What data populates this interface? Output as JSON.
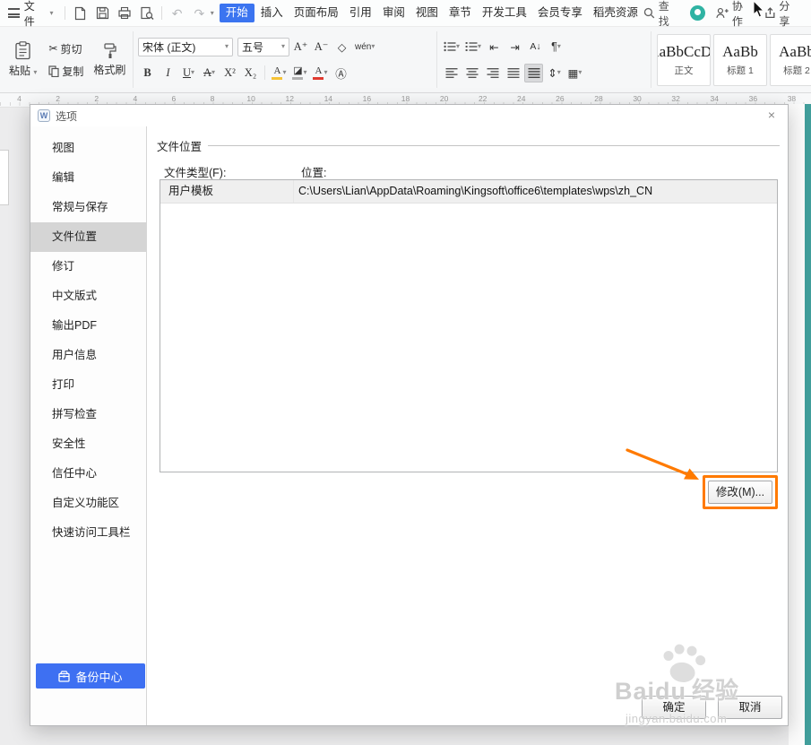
{
  "menubar": {
    "file_label": "文件",
    "tabs": [
      {
        "label": "开始",
        "active": true
      },
      {
        "label": "插入"
      },
      {
        "label": "页面布局"
      },
      {
        "label": "引用"
      },
      {
        "label": "审阅"
      },
      {
        "label": "视图"
      },
      {
        "label": "章节"
      },
      {
        "label": "开发工具"
      },
      {
        "label": "会员专享"
      },
      {
        "label": "稻壳资源"
      }
    ],
    "search_label": "查找",
    "collab_label": "协作",
    "share_label": "分享"
  },
  "ribbon": {
    "paste_label": "粘贴",
    "cut_label": "剪切",
    "copy_label": "复制",
    "format_painter_label": "格式刷",
    "font_name": "宋体 (正文)",
    "font_size": "五号",
    "grow_font_label": "A⁺",
    "shrink_font_label": "A⁻",
    "pinyin_label": "wén",
    "bold_label": "B",
    "italic_label": "I",
    "underline_label": "U",
    "strike_label": "A",
    "superscript_label": "X²",
    "subscript_label": "X₂",
    "highlight_label": "A",
    "shading_glyph": "◪",
    "font_color_label": "A",
    "enclose_label": "Ⓐ",
    "outdent_glyph": "⇤",
    "indent_glyph": "⇥",
    "sort_label": "A↓",
    "marks_glyph": "¶",
    "line_spacing_glyph": "⇕",
    "borders_glyph": "▦",
    "clear_format_glyph": "◇",
    "styles": [
      {
        "sample": "AaBbCcDd",
        "name": "正文"
      },
      {
        "sample": "AaBb",
        "name": "标题 1"
      },
      {
        "sample": "AaBb",
        "name": "标题 2"
      }
    ]
  },
  "ruler": {
    "numbers": [
      "4",
      "2",
      "2",
      "4",
      "6",
      "8",
      "10",
      "12",
      "14",
      "16",
      "18",
      "20",
      "22",
      "24",
      "26",
      "28",
      "30",
      "32",
      "34",
      "36",
      "38"
    ]
  },
  "dialog": {
    "title": "选项",
    "logo_letter": "W",
    "close_glyph": "×",
    "sidebar": {
      "items": [
        {
          "label": "视图"
        },
        {
          "label": "编辑"
        },
        {
          "label": "常规与保存"
        },
        {
          "label": "文件位置",
          "selected": true
        },
        {
          "label": "修订"
        },
        {
          "label": "中文版式"
        },
        {
          "label": "输出PDF"
        },
        {
          "label": "用户信息"
        },
        {
          "label": "打印"
        },
        {
          "label": "拼写检查"
        },
        {
          "label": "安全性"
        },
        {
          "label": "信任中心"
        },
        {
          "label": "自定义功能区"
        },
        {
          "label": "快速访问工具栏"
        }
      ],
      "backup_center_label": "备份中心"
    },
    "content": {
      "section_title": "文件位置",
      "file_type_label": "文件类型(F):",
      "location_label": "位置:",
      "rows": [
        {
          "type": "用户模板",
          "path": "C:\\Users\\Lian\\AppData\\Roaming\\Kingsoft\\office6\\templates\\wps\\zh_CN"
        }
      ],
      "modify_button": "修改(M)...",
      "ok_button": "确定",
      "cancel_button": "取消"
    }
  },
  "watermark": {
    "brand": "Baidu",
    "suffix": "经验",
    "url": "jingyan.baidu.com"
  },
  "colors": {
    "accent_blue": "#3b74f0",
    "backup_blue": "#3e70f2",
    "highlight_orange": "#ff7a00",
    "doc_strip_teal": "#419e9b",
    "selected_sidebar_gray": "#d5d5d5"
  }
}
